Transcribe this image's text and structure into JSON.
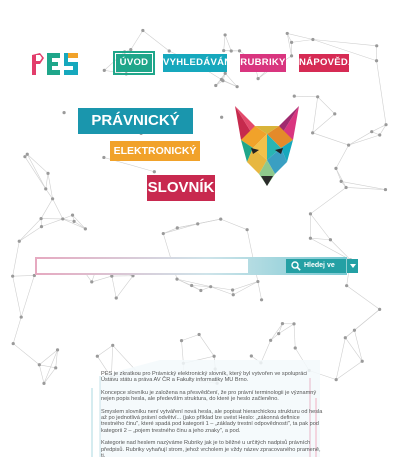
{
  "logo": {
    "text": "PES",
    "colors": [
      "#e23d6b",
      "#1fa68a",
      "#16a8bd",
      "#f1a22a"
    ]
  },
  "nav": {
    "items": [
      {
        "label": "ÚVOD",
        "color": "#1fa68a"
      },
      {
        "label": "VYHLEDÁVÁNÍ",
        "color": "#16a8bd"
      },
      {
        "label": "RUBRIKY",
        "color": "#d9357f"
      },
      {
        "label": "NÁPOVĚDA",
        "color": "#d62b54"
      }
    ]
  },
  "title": {
    "line1": "PRÁVNICKÝ",
    "line2": "ELEKTRONICKÝ",
    "line3": "SLOVNÍK",
    "colors": [
      "#1a96ad",
      "#f1a22a",
      "#c8294f"
    ]
  },
  "search": {
    "value": "",
    "button_label": "Hledej ve slovníku"
  },
  "content": {
    "paragraphs": [
      "PES je zkratkou pro Právnický elektronický slovník, který byl vytvořen ve spolupráci Ústavu státu a práva AV ČR a Fakulty informatiky MU Brno.",
      "Koncepce slovníku je založena na přesvědčení, že pro právní terminologii je významný nejen popis hesla, ale především struktura, do které je heslo začleněno.",
      "Smyslem slovníku není vytváření nová hesla, ale popisat hierarchickou strukturu od hesla až po jednotlivá právní odvětví... (jako příklad lze uvést Heslo: „zákonná definice trestného činu\", které spadá pod kategorii 1 – „základy trestní odpovědnosti\", ta pak pod kategorii 2 – „pojem trestného činu a jeho znaky\", a pod.",
      "Kategorie nad heslem nazýváme Rubriky jak je to běžné u určitých nadpisů právních předpisů. Rubriky vyhaňují strom, jehož vrcholem je vždy název zpracovaného prameně, tj."
    ]
  }
}
